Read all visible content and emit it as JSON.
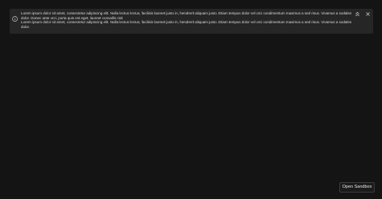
{
  "notification": {
    "icon": "info-icon",
    "lines": [
      "Lorem ipsum dolor sit amet, consectetur adipiscing elit. Nulla lectus lectus, facilisis laoreet justo in, hendrerit aliquam justo. Etiam tempus dolor vel orci condimentum maximus a sed risus. Vivamus a sodales dolor. Donec ante orci, porta quis est eget, laoreet convallis nisl.",
      "Lorem ipsum dolor sit amet, consectetur adipiscing elit. Nulla lectus lectus, facilisis laoreet justo in, hendrerit aliquam justo. Etiam tempus dolor vel orci condimentum maximus a sed risus. Vivamus a sodales dolor."
    ],
    "collapse_icon": "chevron-double-up-icon",
    "close_icon": "close-icon"
  },
  "footer": {
    "open_sandbox_label": "Open Sandbox"
  },
  "colors": {
    "background": "#141414",
    "banner": "#262626",
    "text": "#dddddd"
  }
}
